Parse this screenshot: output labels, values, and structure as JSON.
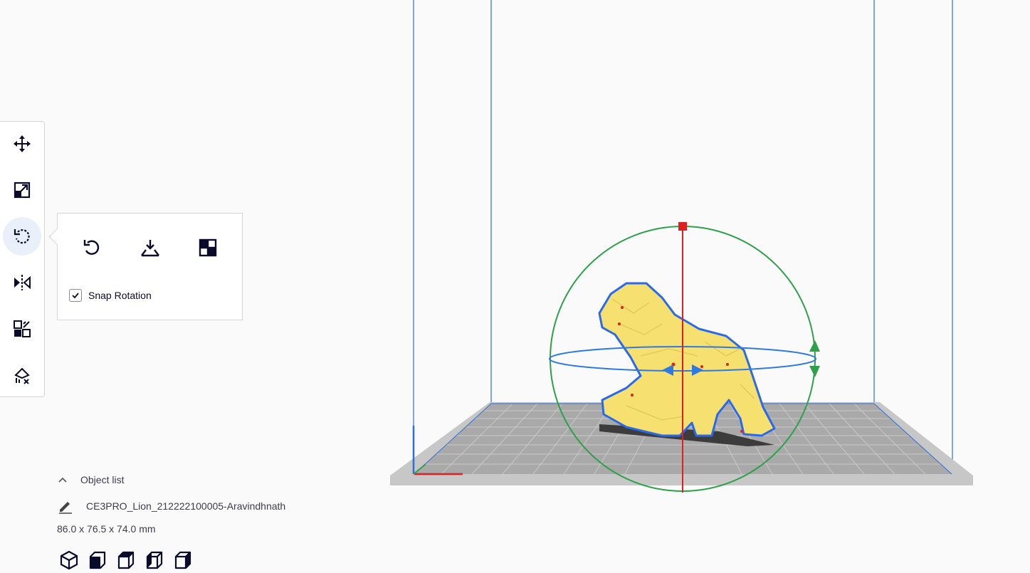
{
  "toolbar": {
    "tools": [
      {
        "name": "move-icon"
      },
      {
        "name": "scale-icon"
      },
      {
        "name": "rotate-icon",
        "active": true
      },
      {
        "name": "mirror-icon"
      },
      {
        "name": "per-model-settings-icon"
      },
      {
        "name": "support-blocker-icon"
      }
    ]
  },
  "rotate_panel": {
    "buttons": [
      "reset-rotation-icon",
      "lay-flat-icon",
      "select-face-to-align-icon"
    ],
    "snap_rotation": {
      "label": "Snap Rotation",
      "checked": true
    }
  },
  "object_list": {
    "title": "Object list",
    "object_name": "CE3PRO_Lion_212222100005-Aravindhnath",
    "dimensions": "86.0 x 76.5 x 74.0 mm",
    "view_buttons": [
      "3d-view-icon",
      "front-view-icon",
      "top-view-icon",
      "left-view-icon",
      "right-view-icon"
    ]
  },
  "scene": {
    "colors": {
      "background": "#fafafa",
      "build_volume_lines": "#2f6fd6",
      "build_plate": "#bdbdbd",
      "model": "#f5e070",
      "model_outline": "#2a6ae8",
      "gizmo_x_ring": "#2f7ae0",
      "gizmo_y_ring": "#2fa04a",
      "gizmo_z_axis": "#e02020"
    }
  }
}
